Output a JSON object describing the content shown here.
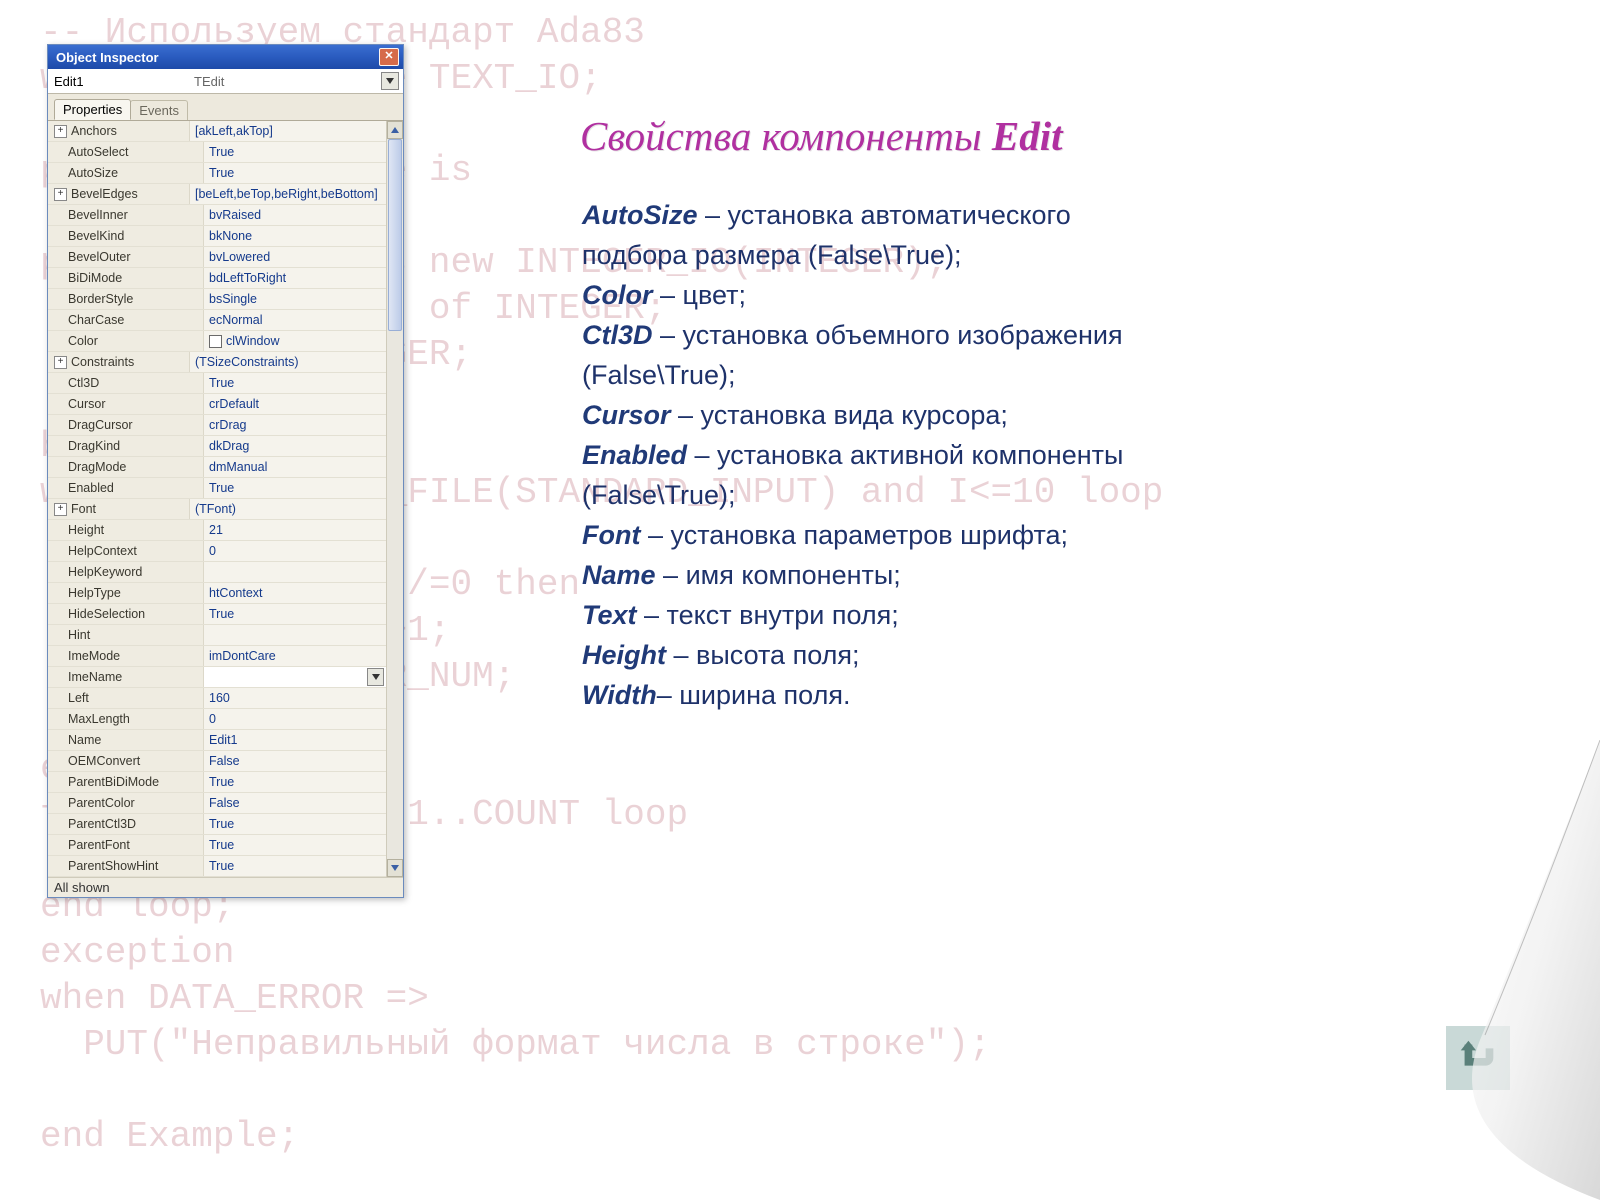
{
  "background_code": "-- Используем стандарт Ada83\nwith TEXT_IO; use TEXT_IO;\n\nprocedure Example is\n\npackage INT_IO is new INTEGER_IO(INTEGER);\n  A: array(1..10) of INTEGER;\n  COUNT, I: INTEGER;\n\nbegin\nwhile not END_OF_FILE(STANDARD_INPUT) and I<=10 loop\n  GET(A(I));\n  if (A(I) mod 2)/=0 then\n    COUNT:=COUNT+1;\n    A(COUNT):=CUR_NUM;\n  end if;\nend loop;\nfor I in reverse 1..COUNT loop\n  PUT(A(I));\nend loop;\nexception\nwhen DATA_ERROR =>\n  PUT(\"Неправильный формат числа в строке\");\n\nend Example;",
  "inspector": {
    "title": "Object Inspector",
    "object_name": "Edit1",
    "object_type": "TEdit",
    "tabs": {
      "properties": "Properties",
      "events": "Events"
    },
    "footer": "All shown",
    "rows": [
      {
        "k": "Anchors",
        "v": "[akLeft,akTop]",
        "expand": true
      },
      {
        "k": "AutoSelect",
        "v": "True",
        "indent": true
      },
      {
        "k": "AutoSize",
        "v": "True",
        "indent": true
      },
      {
        "k": "BevelEdges",
        "v": "[beLeft,beTop,beRight,beBottom]",
        "expand": true
      },
      {
        "k": "BevelInner",
        "v": "bvRaised",
        "indent": true
      },
      {
        "k": "BevelKind",
        "v": "bkNone",
        "indent": true
      },
      {
        "k": "BevelOuter",
        "v": "bvLowered",
        "indent": true
      },
      {
        "k": "BiDiMode",
        "v": "bdLeftToRight",
        "indent": true
      },
      {
        "k": "BorderStyle",
        "v": "bsSingle",
        "indent": true
      },
      {
        "k": "CharCase",
        "v": "ecNormal",
        "indent": true
      },
      {
        "k": "Color",
        "v": "clWindow",
        "indent": true,
        "checkbox": true
      },
      {
        "k": "Constraints",
        "v": "(TSizeConstraints)",
        "expand": true
      },
      {
        "k": "Ctl3D",
        "v": "True",
        "indent": true
      },
      {
        "k": "Cursor",
        "v": "crDefault",
        "indent": true
      },
      {
        "k": "DragCursor",
        "v": "crDrag",
        "indent": true
      },
      {
        "k": "DragKind",
        "v": "dkDrag",
        "indent": true
      },
      {
        "k": "DragMode",
        "v": "dmManual",
        "indent": true
      },
      {
        "k": "Enabled",
        "v": "True",
        "indent": true
      },
      {
        "k": "Font",
        "v": "(TFont)",
        "expand": true
      },
      {
        "k": "Height",
        "v": "21",
        "indent": true
      },
      {
        "k": "HelpContext",
        "v": "0",
        "indent": true
      },
      {
        "k": "HelpKeyword",
        "v": "",
        "indent": true
      },
      {
        "k": "HelpType",
        "v": "htContext",
        "indent": true
      },
      {
        "k": "HideSelection",
        "v": "True",
        "indent": true
      },
      {
        "k": "Hint",
        "v": "",
        "indent": true
      },
      {
        "k": "ImeMode",
        "v": "imDontCare",
        "indent": true
      },
      {
        "k": "ImeName",
        "v": "",
        "indent": true,
        "editing": true
      },
      {
        "k": "Left",
        "v": "160",
        "indent": true
      },
      {
        "k": "MaxLength",
        "v": "0",
        "indent": true
      },
      {
        "k": "Name",
        "v": "Edit1",
        "indent": true
      },
      {
        "k": "OEMConvert",
        "v": "False",
        "indent": true
      },
      {
        "k": "ParentBiDiMode",
        "v": "True",
        "indent": true
      },
      {
        "k": "ParentColor",
        "v": "False",
        "indent": true
      },
      {
        "k": "ParentCtl3D",
        "v": "True",
        "indent": true
      },
      {
        "k": "ParentFont",
        "v": "True",
        "indent": true
      },
      {
        "k": "ParentShowHint",
        "v": "True",
        "indent": true
      }
    ]
  },
  "heading": {
    "prefix": "Свойства компоненты ",
    "strong": "Edit"
  },
  "body_items": [
    {
      "term": "AutoSize",
      "text": " – установка автоматического подбора размера (False\\True);"
    },
    {
      "term": "Color",
      "text": " – цвет;"
    },
    {
      "term": "Ctl3D",
      "text": " – установка объемного изображения (False\\True);"
    },
    {
      "term": "Cursor",
      "text": " – установка вида курсора;"
    },
    {
      "term": "Enabled",
      "text": " – установка активной компоненты (False\\True);"
    },
    {
      "term": "Font",
      "text": " – установка параметров шрифта;"
    },
    {
      "term": "Name",
      "text": " – имя компоненты;"
    },
    {
      "term": "Text",
      "text": " – текст внутри поля;"
    },
    {
      "term": "Height",
      "text": " – высота поля;"
    },
    {
      "term": "Width",
      "text": "– ширина поля."
    }
  ]
}
